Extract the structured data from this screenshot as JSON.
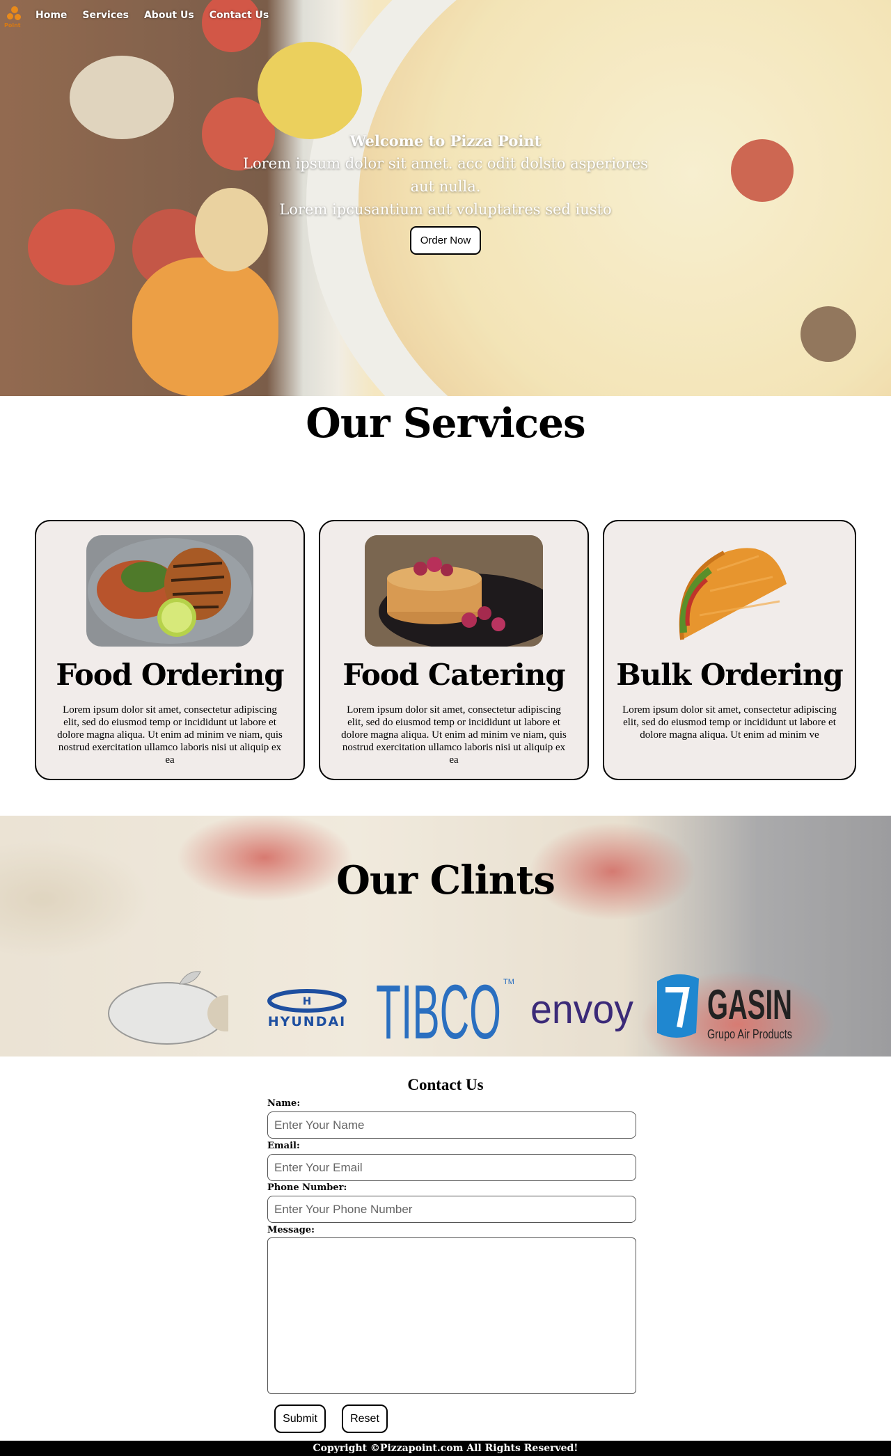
{
  "nav": {
    "logo_text": "Point",
    "items": [
      {
        "label": "Home"
      },
      {
        "label": "Services"
      },
      {
        "label": "About Us"
      },
      {
        "label": "Contact Us"
      }
    ]
  },
  "hero": {
    "heading": "Welcome to Pizza Point",
    "line1": "Lorem ipsum dolor sit amet. acc odit dolsto asperiores",
    "line2": "aut nulla.",
    "line3": "Lorem ipcusantium aut voluptatres sed iusto",
    "button_label": "Order Now"
  },
  "services": {
    "title": "Our Services",
    "cards": [
      {
        "title": "Food Ordering",
        "text": "Lorem ipsum dolor sit amet, consectetur adipiscing elit, sed do eiusmod temp or incididunt ut labore et dolore magna aliqua. Ut enim ad minim ve niam, quis nostrud exercitation ullamco laboris nisi ut aliquip ex ea"
      },
      {
        "title": "Food Catering",
        "text": "Lorem ipsum dolor sit amet, consectetur adipiscing elit, sed do eiusmod temp or incididunt ut labore et dolore magna aliqua. Ut enim ad minim ve niam, quis nostrud exercitation ullamco laboris nisi ut aliquip ex ea"
      },
      {
        "title": "Bulk Ordering",
        "text": "Lorem ipsum dolor sit amet, consectetur adipiscing elit, sed do eiusmod temp or incididunt ut labore et dolore magna aliqua. Ut enim ad minim ve"
      }
    ]
  },
  "clients": {
    "title": "Our Clints",
    "brands": {
      "hyundai": "HYUNDAI",
      "tibco": "TIBCO",
      "tm": "TM",
      "envoy": "envoy",
      "gasin": "GASIN",
      "gasin_sub": "Grupo Air Products"
    }
  },
  "contact": {
    "title": "Contact Us",
    "name_label": "Name:",
    "name_placeholder": "Enter Your Name",
    "email_label": "Email:",
    "email_placeholder": "Enter Your Email",
    "phone_label": "Phone Number:",
    "phone_placeholder": "Enter Your Phone Number",
    "message_label": "Message:",
    "submit_label": "Submit",
    "reset_label": "Reset"
  },
  "footer": {
    "text": "Copyright ©Pizzapoint.com All Rights Reserved!"
  },
  "colors": {
    "accent_orange": "#e98a1a",
    "hyundai_blue": "#1e4fa0",
    "tibco_blue": "#2a6fc0",
    "envoy_purple": "#3b2a78",
    "gasin_blue": "#1f87d0"
  }
}
